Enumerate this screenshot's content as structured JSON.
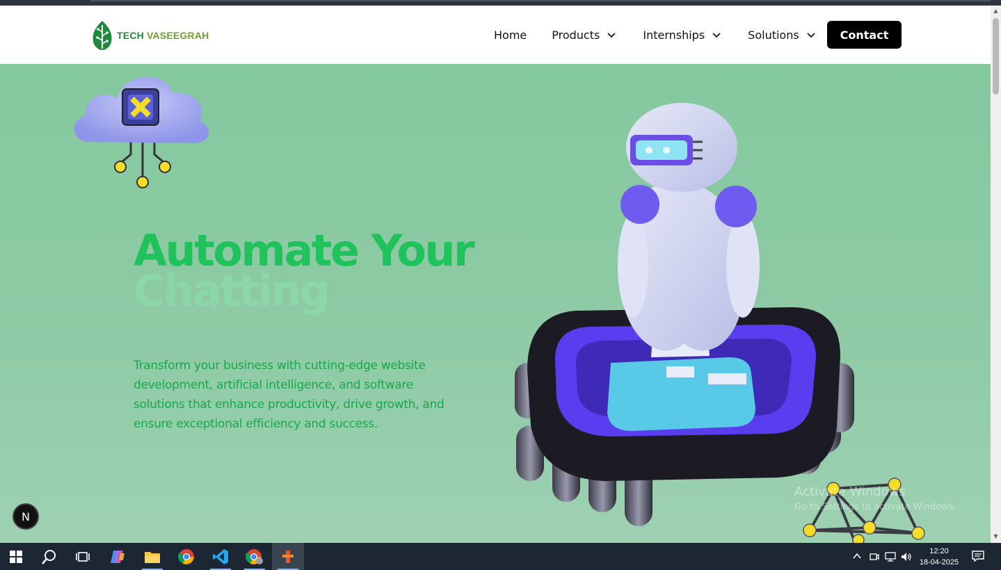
{
  "brand": {
    "name_part1": "TECH ",
    "name_part2": "VASEEGRAH"
  },
  "nav": {
    "items": [
      {
        "label": "Home",
        "dropdown": false
      },
      {
        "label": "Products",
        "dropdown": true
      },
      {
        "label": "Internships",
        "dropdown": true
      },
      {
        "label": "Solutions",
        "dropdown": true
      }
    ],
    "contact_label": "Contact"
  },
  "hero": {
    "headline": "Automate Your",
    "rotating_word": "Chatting",
    "description": "Transform your business with cutting-edge website development, artificial intelligence, and software solutions that enhance productivity, drive growth, and ensure exceptional efficiency and success."
  },
  "overlay": {
    "activate_title": "Activate Windows",
    "activate_sub": "Go to Settings to activate Windows.",
    "dev_badge": "N"
  },
  "taskbar": {
    "apps": [
      "start-icon",
      "search-icon",
      "task-view-icon",
      "copilot-icon",
      "file-explorer-icon",
      "chrome-icon",
      "vscode-icon",
      "chrome-profile-icon",
      "app-icon"
    ],
    "time": "12:20",
    "date": "18-04-2025"
  },
  "colors": {
    "accent_green": "#1fc25b",
    "hero_bg": "#86c9a0",
    "contact_bg": "#000000"
  }
}
